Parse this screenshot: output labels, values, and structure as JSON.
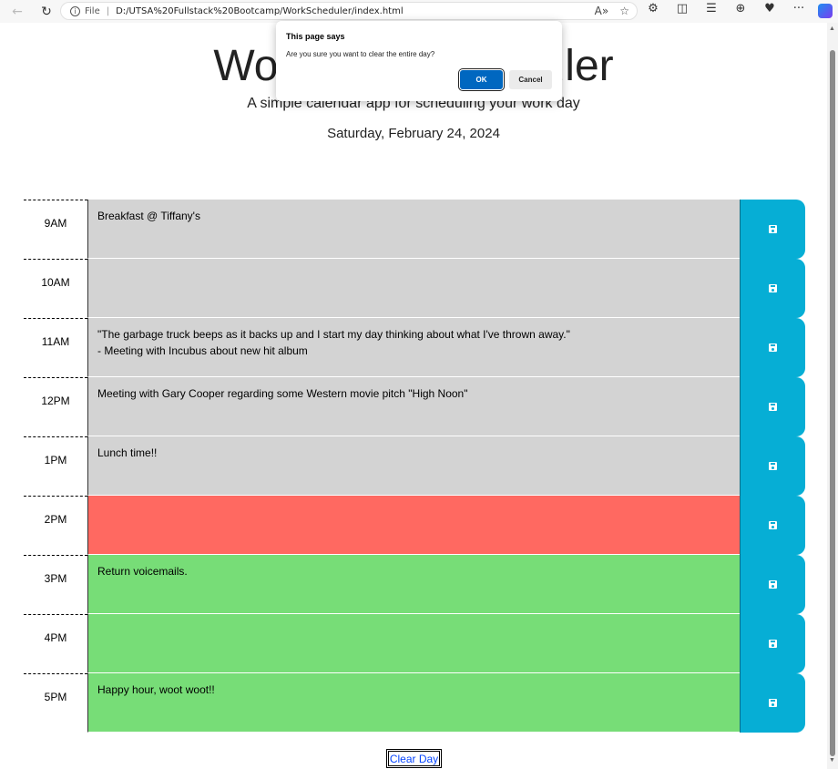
{
  "browser": {
    "back_icon": "←",
    "refresh_icon": "↻",
    "info_icon": "i",
    "scheme_label": "File",
    "separator": "|",
    "url": "D:/UTSA%20Fullstack%20Bootcamp/WorkScheduler/index.html",
    "read_aloud_icon": "A»",
    "favorite_icon": "☆",
    "extensions_icon": "⚙",
    "split_icon": "◫",
    "favorites_bar_icon": "☰",
    "collections_icon": "⊕",
    "performance_icon": "♥",
    "more_icon": "···"
  },
  "header": {
    "title": "Work Day Scheduler",
    "lead": "A simple calendar app for scheduling your work day",
    "current_day": "Saturday, February 24, 2024"
  },
  "rows": [
    {
      "hour": "9AM",
      "text": "Breakfast @ Tiffany's",
      "state": "past"
    },
    {
      "hour": "10AM",
      "text": "",
      "state": "past"
    },
    {
      "hour": "11AM",
      "text": "\"The garbage truck beeps as it backs up and I start my day thinking about what I've thrown away.\"\n- Meeting with Incubus about new hit album",
      "state": "past"
    },
    {
      "hour": "12PM",
      "text": "Meeting with Gary Cooper regarding some Western movie pitch \"High Noon\"",
      "state": "past"
    },
    {
      "hour": "1PM",
      "text": "Lunch time!!",
      "state": "past"
    },
    {
      "hour": "2PM",
      "text": "",
      "state": "present"
    },
    {
      "hour": "3PM",
      "text": "Return voicemails.",
      "state": "future"
    },
    {
      "hour": "4PM",
      "text": "",
      "state": "future"
    },
    {
      "hour": "5PM",
      "text": "Happy hour, woot woot!!",
      "state": "future"
    }
  ],
  "save_icon": "floppy-disk-icon",
  "clear_button_label": "Clear Day",
  "dialog": {
    "title": "This page says",
    "message": "Are you sure you want to clear the entire day?",
    "ok_label": "OK",
    "cancel_label": "Cancel"
  },
  "colors": {
    "past": "#d3d3d3",
    "present": "#ff6961",
    "future": "#77dd77",
    "save": "#06aed5"
  }
}
